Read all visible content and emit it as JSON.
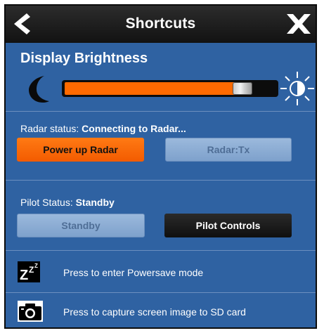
{
  "header": {
    "title": "Shortcuts"
  },
  "display": {
    "section_title": "Display Brightness",
    "brightness_level": 0.88
  },
  "radar": {
    "status_label": "Radar status:",
    "status_value": "Connecting to Radar...",
    "power_button": "Power up Radar",
    "tx_button": "Radar:Tx"
  },
  "pilot": {
    "status_label": "Pilot Status:",
    "status_value": "Standby",
    "standby_button": "Standby",
    "controls_button": "Pilot Controls"
  },
  "powersave": {
    "text": "Press to enter Powersave mode",
    "icon": "sleep-zzz-icon"
  },
  "capture": {
    "text": "Press to capture screen image to SD card",
    "icon": "camera-icon"
  },
  "colors": {
    "panel": "#2f62a2",
    "accent": "#ff6a00",
    "titlebar": "#1a1a1a"
  }
}
